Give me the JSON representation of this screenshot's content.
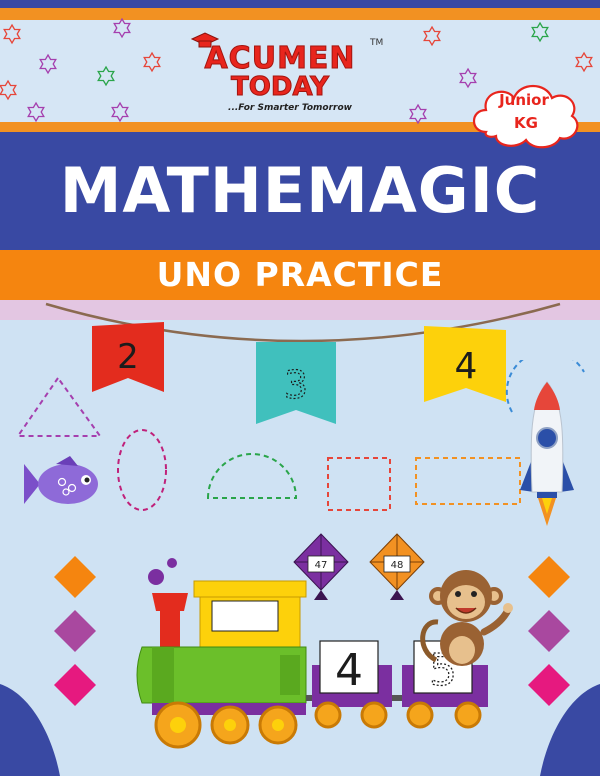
{
  "brand": {
    "line1": "ACUMEN",
    "line2": "TODAY",
    "trademark": "TM",
    "tagline": "...For Smarter Tomorrow"
  },
  "badge": {
    "line1": "Junior",
    "line2": "KG"
  },
  "title": "MATHEMAGIC",
  "subtitle": "UNO PRACTICE",
  "flags": [
    "2",
    "3",
    "4"
  ],
  "kites": [
    "47",
    "48"
  ],
  "wagons": [
    "4",
    "5"
  ],
  "colors": {
    "blue_band": "#3949a3",
    "orange_band": "#f5850f",
    "background": "#cfe2f3",
    "brand_red": "#e8251d"
  },
  "icons": [
    "star-icon",
    "graduation-cap-icon",
    "fish-icon",
    "rocket-icon",
    "train-icon",
    "monkey-icon",
    "kite-icon",
    "diamond-icon"
  ]
}
